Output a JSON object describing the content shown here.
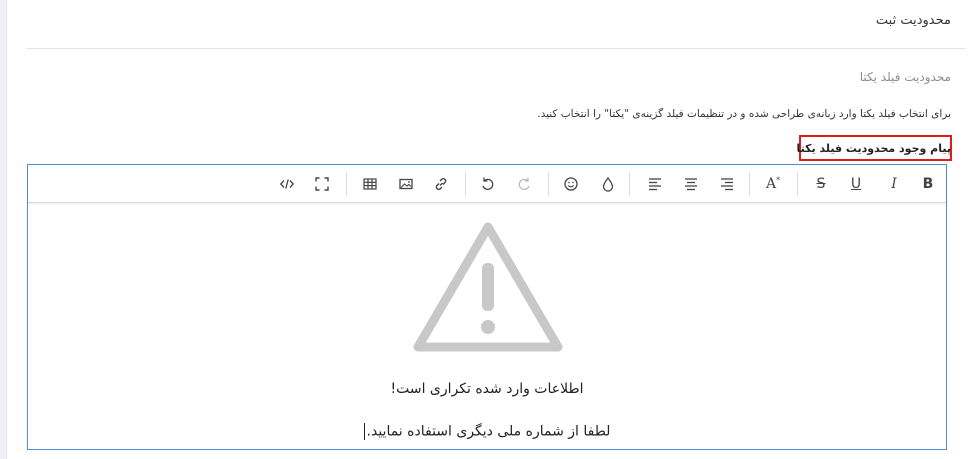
{
  "section": {
    "title": "محدودیت ثبت"
  },
  "field": {
    "title": "محدودیت فیلد یکتا",
    "help": "برای انتخاب فیلد یکتا وارد زبانه‌ی طراحی شده و در تنظیمات فیلد گزینه‌ی \"یکتا\" را انتخاب کنید.",
    "message_label": "پیام وجود محدودیت فیلد یکتا"
  },
  "editor": {
    "toolbar": {
      "bold": "B",
      "italic": "I",
      "underline": "U",
      "strike": "S",
      "font_size": "A"
    },
    "content": {
      "line1": "اطلاعات وارد شده تکراری است!",
      "line2": "لطفا از شماره ملی دیگری استفاده نمایید."
    },
    "icons": [
      "bold-icon",
      "italic-icon",
      "underline-icon",
      "strikethrough-icon",
      "font-size-icon",
      "align-right-icon",
      "align-center-icon",
      "align-left-icon",
      "color-drop-icon",
      "emoji-icon",
      "redo-icon",
      "undo-icon",
      "link-icon",
      "image-icon",
      "table-icon",
      "fullscreen-icon",
      "code-view-icon",
      "warning-icon"
    ]
  },
  "colors": {
    "editor_border": "#4a90d9",
    "highlight_box": "#e11c1c",
    "warning_icon": "#c8c8c8"
  }
}
